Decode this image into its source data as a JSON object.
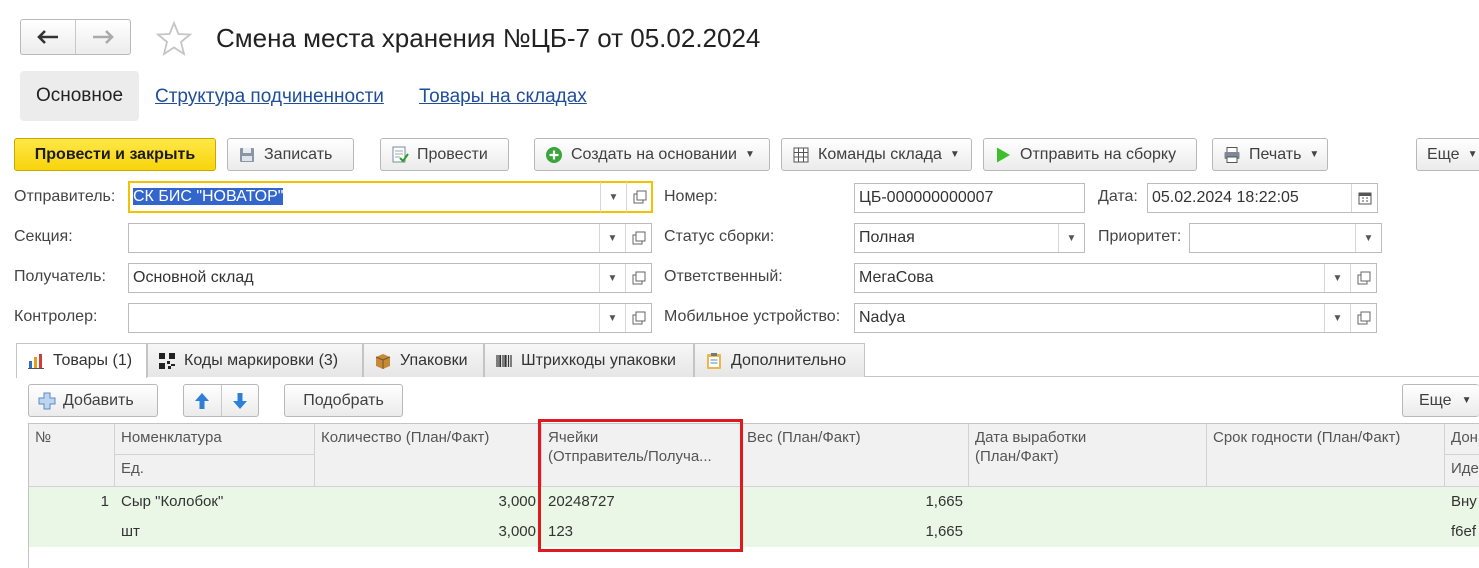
{
  "title": "Смена места хранения №ЦБ-7 от 05.02.2024",
  "nav": {
    "back_icon": "arrow-left-icon",
    "forward_icon": "arrow-right-icon",
    "favorite_icon": "star-icon"
  },
  "sections": [
    {
      "label": "Основное"
    },
    {
      "label": "Структура подчиненности"
    },
    {
      "label": "Товары на складах"
    }
  ],
  "toolbar": {
    "post_close": "Провести и закрыть",
    "save": "Записать",
    "post": "Провести",
    "create_based": "Создать на основании",
    "warehouse_cmds": "Команды склада",
    "send_assembly": "Отправить на сборку",
    "print": "Печать",
    "more": "Еще"
  },
  "form": {
    "sender_label": "Отправитель:",
    "sender_value": "СК БИС \"НОВАТОР\"",
    "section_label": "Секция:",
    "section_value": "",
    "receiver_label": "Получатель:",
    "receiver_value": "Основной склад",
    "controller_label": "Контролер:",
    "controller_value": "",
    "number_label": "Номер:",
    "number_value": "ЦБ-000000000007",
    "date_label": "Дата:",
    "date_value": "05.02.2024 18:22:05",
    "status_label": "Статус сборки:",
    "status_value": "Полная",
    "priority_label": "Приоритет:",
    "priority_value": "",
    "responsible_label": "Ответственный:",
    "responsible_value": "МегаСова",
    "device_label": "Мобильное устройство:",
    "device_value": "Nadya"
  },
  "tabs": [
    {
      "label": "Товары (1)"
    },
    {
      "label": "Коды маркировки  (3)"
    },
    {
      "label": "Упаковки"
    },
    {
      "label": "Штрихкоды упаковки"
    },
    {
      "label": "Дополнительно"
    }
  ],
  "table_toolbar": {
    "add": "Добавить",
    "pick": "Подобрать",
    "more": "Еще"
  },
  "table": {
    "headers": {
      "num": "№",
      "nom": "Номенклатура",
      "unit": "Ед.",
      "qty": "Количество (План/Факт)",
      "cells_1": "Ячейки",
      "cells_2": "(Отправитель/Получа...",
      "weight": "Вес (План/Факт)",
      "prod_date_1": "Дата выработки",
      "prod_date_2": "(План/Факт)",
      "shelf": "Срок годности  (План/Факт)",
      "extra_1": "Дон",
      "extra_2": "Иде"
    },
    "rows": [
      {
        "num": "1",
        "nom": "Сыр \"Колобок\"",
        "unit": "шт",
        "qty_plan": "3,000",
        "qty_fact": "3,000",
        "cell_sender": "20248727",
        "cell_receiver": "123",
        "weight_plan": "1,665",
        "weight_fact": "1,665",
        "extra_1": "Вну",
        "extra_2": "f6ef"
      }
    ]
  }
}
